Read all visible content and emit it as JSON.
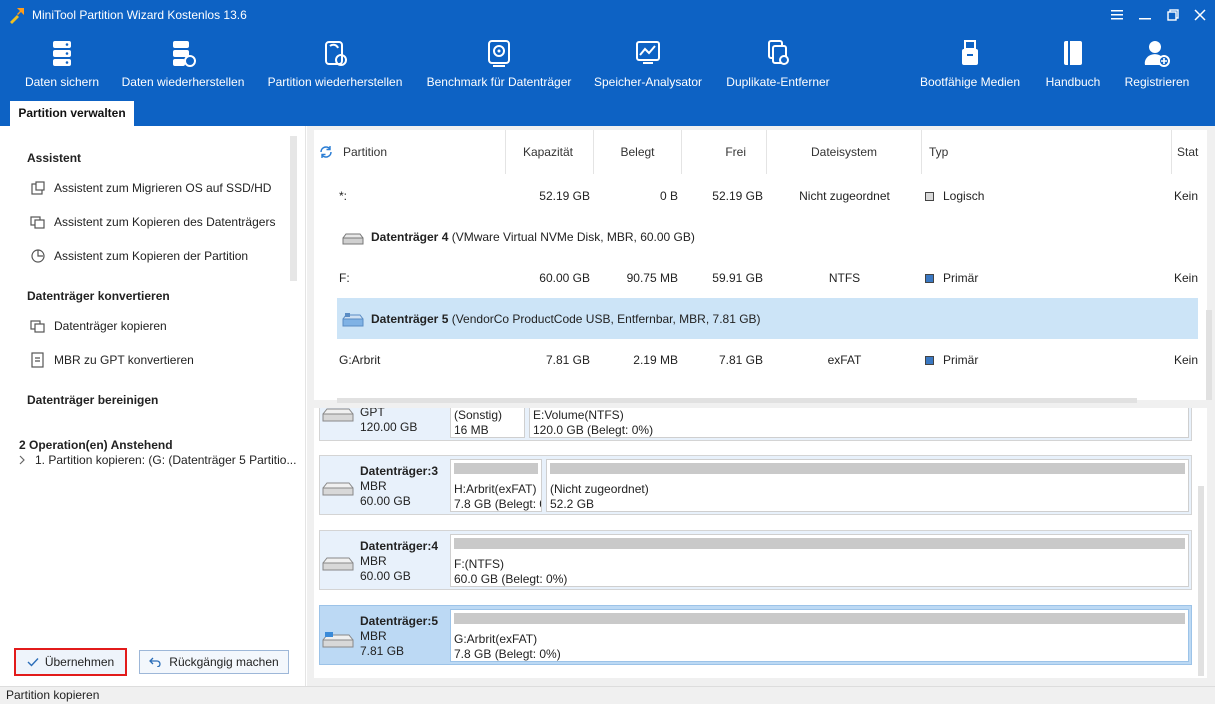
{
  "window": {
    "title": "MiniTool Partition Wizard Kostenlos 13.6"
  },
  "toolbar": {
    "items": [
      {
        "label": "Daten sichern",
        "icon": "backup-icon"
      },
      {
        "label": "Daten wiederherstellen",
        "icon": "data-recovery-icon"
      },
      {
        "label": "Partition wiederherstellen",
        "icon": "partition-recovery-icon"
      },
      {
        "label": "Benchmark für Datenträger",
        "icon": "benchmark-icon"
      },
      {
        "label": "Speicher-Analysator",
        "icon": "space-analyzer-icon"
      },
      {
        "label": "Duplikate-Entferner",
        "icon": "duplicate-remover-icon"
      },
      {
        "label": "Bootfähige Medien",
        "icon": "bootable-media-icon"
      },
      {
        "label": "Handbuch",
        "icon": "manual-icon"
      },
      {
        "label": "Registrieren",
        "icon": "register-icon"
      }
    ],
    "active_tab": "Partition verwalten"
  },
  "sidebar": {
    "sections": [
      {
        "title": "Assistent",
        "items": [
          "Assistent zum Migrieren OS auf SSD/HD",
          "Assistent zum Kopieren des Datenträgers",
          "Assistent zum Kopieren der Partition"
        ]
      },
      {
        "title": "Datenträger konvertieren",
        "items": [
          "Datenträger kopieren",
          "MBR zu GPT konvertieren"
        ]
      },
      {
        "title": "Datenträger bereinigen",
        "items": []
      }
    ],
    "pending_title": "2 Operation(en) Anstehend",
    "pending_items": [
      "1. Partition kopieren: (G: (Datenträger 5 Partitio..."
    ],
    "apply_label": "Übernehmen",
    "undo_label": "Rückgängig machen"
  },
  "table": {
    "columns": [
      "Partition",
      "Kapazität",
      "Belegt",
      "Frei",
      "Dateisystem",
      "Typ",
      "Stat"
    ],
    "rows": [
      {
        "kind": "partition",
        "partition": "*:",
        "capacity": "52.19 GB",
        "used": "0 B",
        "free": "52.19 GB",
        "fs": "Nicht zugeordnet",
        "type": "Logisch",
        "status": "Kein"
      },
      {
        "kind": "disk",
        "name": "Datenträger 4",
        "detail": "(VMware Virtual NVMe Disk, MBR, 60.00 GB)"
      },
      {
        "kind": "partition",
        "partition": "F:",
        "capacity": "60.00 GB",
        "used": "90.75 MB",
        "free": "59.91 GB",
        "fs": "NTFS",
        "type": "Primär",
        "status": "Kein"
      },
      {
        "kind": "disk",
        "name": "Datenträger 5",
        "detail": "(VendorCo ProductCode USB, Entfernbar, MBR, 7.81 GB)",
        "selected": true
      },
      {
        "kind": "partition",
        "partition": "G:Arbrit",
        "capacity": "7.81 GB",
        "used": "2.19 MB",
        "free": "7.81 GB",
        "fs": "exFAT",
        "type": "Primär",
        "status": "Kein"
      }
    ],
    "type_colors": {
      "Logisch": "#d9d9d9",
      "Primär": "#3a78c2"
    }
  },
  "diskmap": {
    "disks": [
      {
        "name": "",
        "type": "GPT",
        "size": "120.00 GB",
        "partitions": [
          {
            "label": "(Sonstig)",
            "info": "16 MB",
            "used_fraction": 0
          },
          {
            "label": "E:Volume(NTFS)",
            "info": "120.0 GB (Belegt: 0%)",
            "used_fraction": 0
          }
        ]
      },
      {
        "name": "Datenträger:3",
        "type": "MBR",
        "size": "60.00 GB",
        "partitions": [
          {
            "label": "H:Arbrit(exFAT)",
            "info": "7.8 GB (Belegt: 0",
            "used_fraction": 0
          },
          {
            "label": "(Nicht zugeordnet)",
            "info": "52.2 GB",
            "used_fraction": 0
          }
        ]
      },
      {
        "name": "Datenträger:4",
        "type": "MBR",
        "size": "60.00 GB",
        "partitions": [
          {
            "label": "F:(NTFS)",
            "info": "60.0 GB (Belegt: 0%)",
            "used_fraction": 0
          }
        ]
      },
      {
        "name": "Datenträger:5",
        "type": "MBR",
        "size": "7.81 GB",
        "selected": true,
        "partitions": [
          {
            "label": "G:Arbrit(exFAT)",
            "info": "7.8 GB (Belegt: 0%)",
            "used_fraction": 0
          }
        ]
      }
    ]
  },
  "statusbar": {
    "text": "Partition kopieren"
  },
  "colors": {
    "accent": "#0d62c4",
    "selection": "#cce4f7",
    "apply_border": "#e21b1b"
  }
}
